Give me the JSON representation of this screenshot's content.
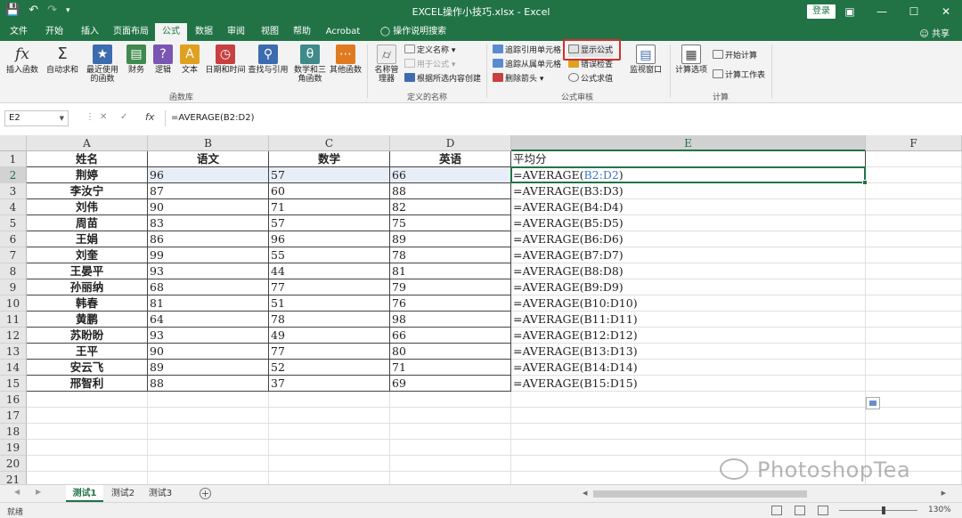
{
  "window": {
    "title": "EXCEL操作小技巧.xlsx - Excel",
    "login_label": "登录",
    "share_label": "共享"
  },
  "menu": {
    "tabs": [
      "文件",
      "开始",
      "插入",
      "页面布局",
      "公式",
      "数据",
      "审阅",
      "视图",
      "帮助",
      "Acrobat",
      "操作说明搜索"
    ],
    "active": "公式"
  },
  "ribbon": {
    "function_library": {
      "label": "函数库",
      "buttons": [
        "插入函数",
        "自动求和",
        "最近使用的函数",
        "财务",
        "逻辑",
        "文本",
        "日期和时间",
        "查找与引用",
        "数学和三角函数",
        "其他函数"
      ]
    },
    "defined_names": {
      "label": "定义的名称",
      "manager": "名称管理器",
      "items": [
        "定义名称",
        "用于公式",
        "根据所选内容创建"
      ]
    },
    "formula_auditing": {
      "label": "公式审核",
      "items": [
        "追踪引用单元格",
        "追踪从属单元格",
        "删除箭头",
        "显示公式",
        "错误检查",
        "公式求值"
      ],
      "watch": "监视窗口"
    },
    "calculation": {
      "label": "计算",
      "options": "计算选项",
      "items": [
        "开始计算",
        "计算工作表"
      ]
    }
  },
  "formula_bar": {
    "name_box": "E2",
    "formula": "=AVERAGE(B2:D2)"
  },
  "sheet": {
    "columns": [
      "A",
      "B",
      "C",
      "D",
      "E",
      "F"
    ],
    "selected_column": "E",
    "row_numbers": [
      "1",
      "2",
      "3",
      "4",
      "5",
      "6",
      "7",
      "8",
      "9",
      "10",
      "11",
      "12",
      "13",
      "14",
      "15",
      "16",
      "17",
      "18",
      "19",
      "20",
      "21"
    ],
    "selected_row": "2",
    "headers": [
      "姓名",
      "语文",
      "数学",
      "英语",
      "平均分"
    ],
    "rows": [
      {
        "name": "荆婷",
        "b": "96",
        "c": "57",
        "d": "66",
        "f_pre": "=AVERAGE(",
        "f_ref": "B2:D2",
        "f_post": ")"
      },
      {
        "name": "李汝宁",
        "b": "87",
        "c": "60",
        "d": "88",
        "f_pre": "=AVERAGE(",
        "f_ref": "B3:D3",
        "f_post": ")"
      },
      {
        "name": "刘伟",
        "b": "90",
        "c": "71",
        "d": "82",
        "f_pre": "=AVERAGE(",
        "f_ref": "B4:D4",
        "f_post": ")"
      },
      {
        "name": "周苗",
        "b": "83",
        "c": "57",
        "d": "75",
        "f_pre": "=AVERAGE(",
        "f_ref": "B5:D5",
        "f_post": ")"
      },
      {
        "name": "王娟",
        "b": "86",
        "c": "96",
        "d": "89",
        "f_pre": "=AVERAGE(",
        "f_ref": "B6:D6",
        "f_post": ")"
      },
      {
        "name": "刘奎",
        "b": "99",
        "c": "55",
        "d": "78",
        "f_pre": "=AVERAGE(",
        "f_ref": "B7:D7",
        "f_post": ")"
      },
      {
        "name": "王晏平",
        "b": "93",
        "c": "44",
        "d": "81",
        "f_pre": "=AVERAGE(",
        "f_ref": "B8:D8",
        "f_post": ")"
      },
      {
        "name": "孙丽纳",
        "b": "68",
        "c": "77",
        "d": "79",
        "f_pre": "=AVERAGE(",
        "f_ref": "B9:D9",
        "f_post": ")"
      },
      {
        "name": "韩春",
        "b": "81",
        "c": "51",
        "d": "76",
        "f_pre": "=AVERAGE(",
        "f_ref": "B10:D10",
        "f_post": ")"
      },
      {
        "name": "黄鹏",
        "b": "64",
        "c": "78",
        "d": "98",
        "f_pre": "=AVERAGE(",
        "f_ref": "B11:D11",
        "f_post": ")"
      },
      {
        "name": "苏盼盼",
        "b": "93",
        "c": "49",
        "d": "66",
        "f_pre": "=AVERAGE(",
        "f_ref": "B12:D12",
        "f_post": ")"
      },
      {
        "name": "王平",
        "b": "90",
        "c": "77",
        "d": "80",
        "f_pre": "=AVERAGE(",
        "f_ref": "B13:D13",
        "f_post": ")"
      },
      {
        "name": "安云飞",
        "b": "89",
        "c": "52",
        "d": "71",
        "f_pre": "=AVERAGE(",
        "f_ref": "B14:D14",
        "f_post": ")"
      },
      {
        "name": "邢智利",
        "b": "88",
        "c": "37",
        "d": "69",
        "f_pre": "=AVERAGE(",
        "f_ref": "B15:D15",
        "f_post": ")"
      }
    ]
  },
  "sheet_tabs": {
    "tabs": [
      "测试1",
      "测试2",
      "测试3"
    ],
    "active": "测试1",
    "add_label": "+"
  },
  "status": {
    "ready": "就绪",
    "zoom": "130%"
  },
  "watermark": "PhotoshopTea",
  "colors": {
    "excel_green": "#217346",
    "reference_blue": "#3c78c8",
    "highlight_red": "#d0312d"
  },
  "icons": [
    "save-icon",
    "undo-icon",
    "redo-icon",
    "lightbulb-icon",
    "user-icon",
    "fx-icon",
    "sigma-icon"
  ]
}
